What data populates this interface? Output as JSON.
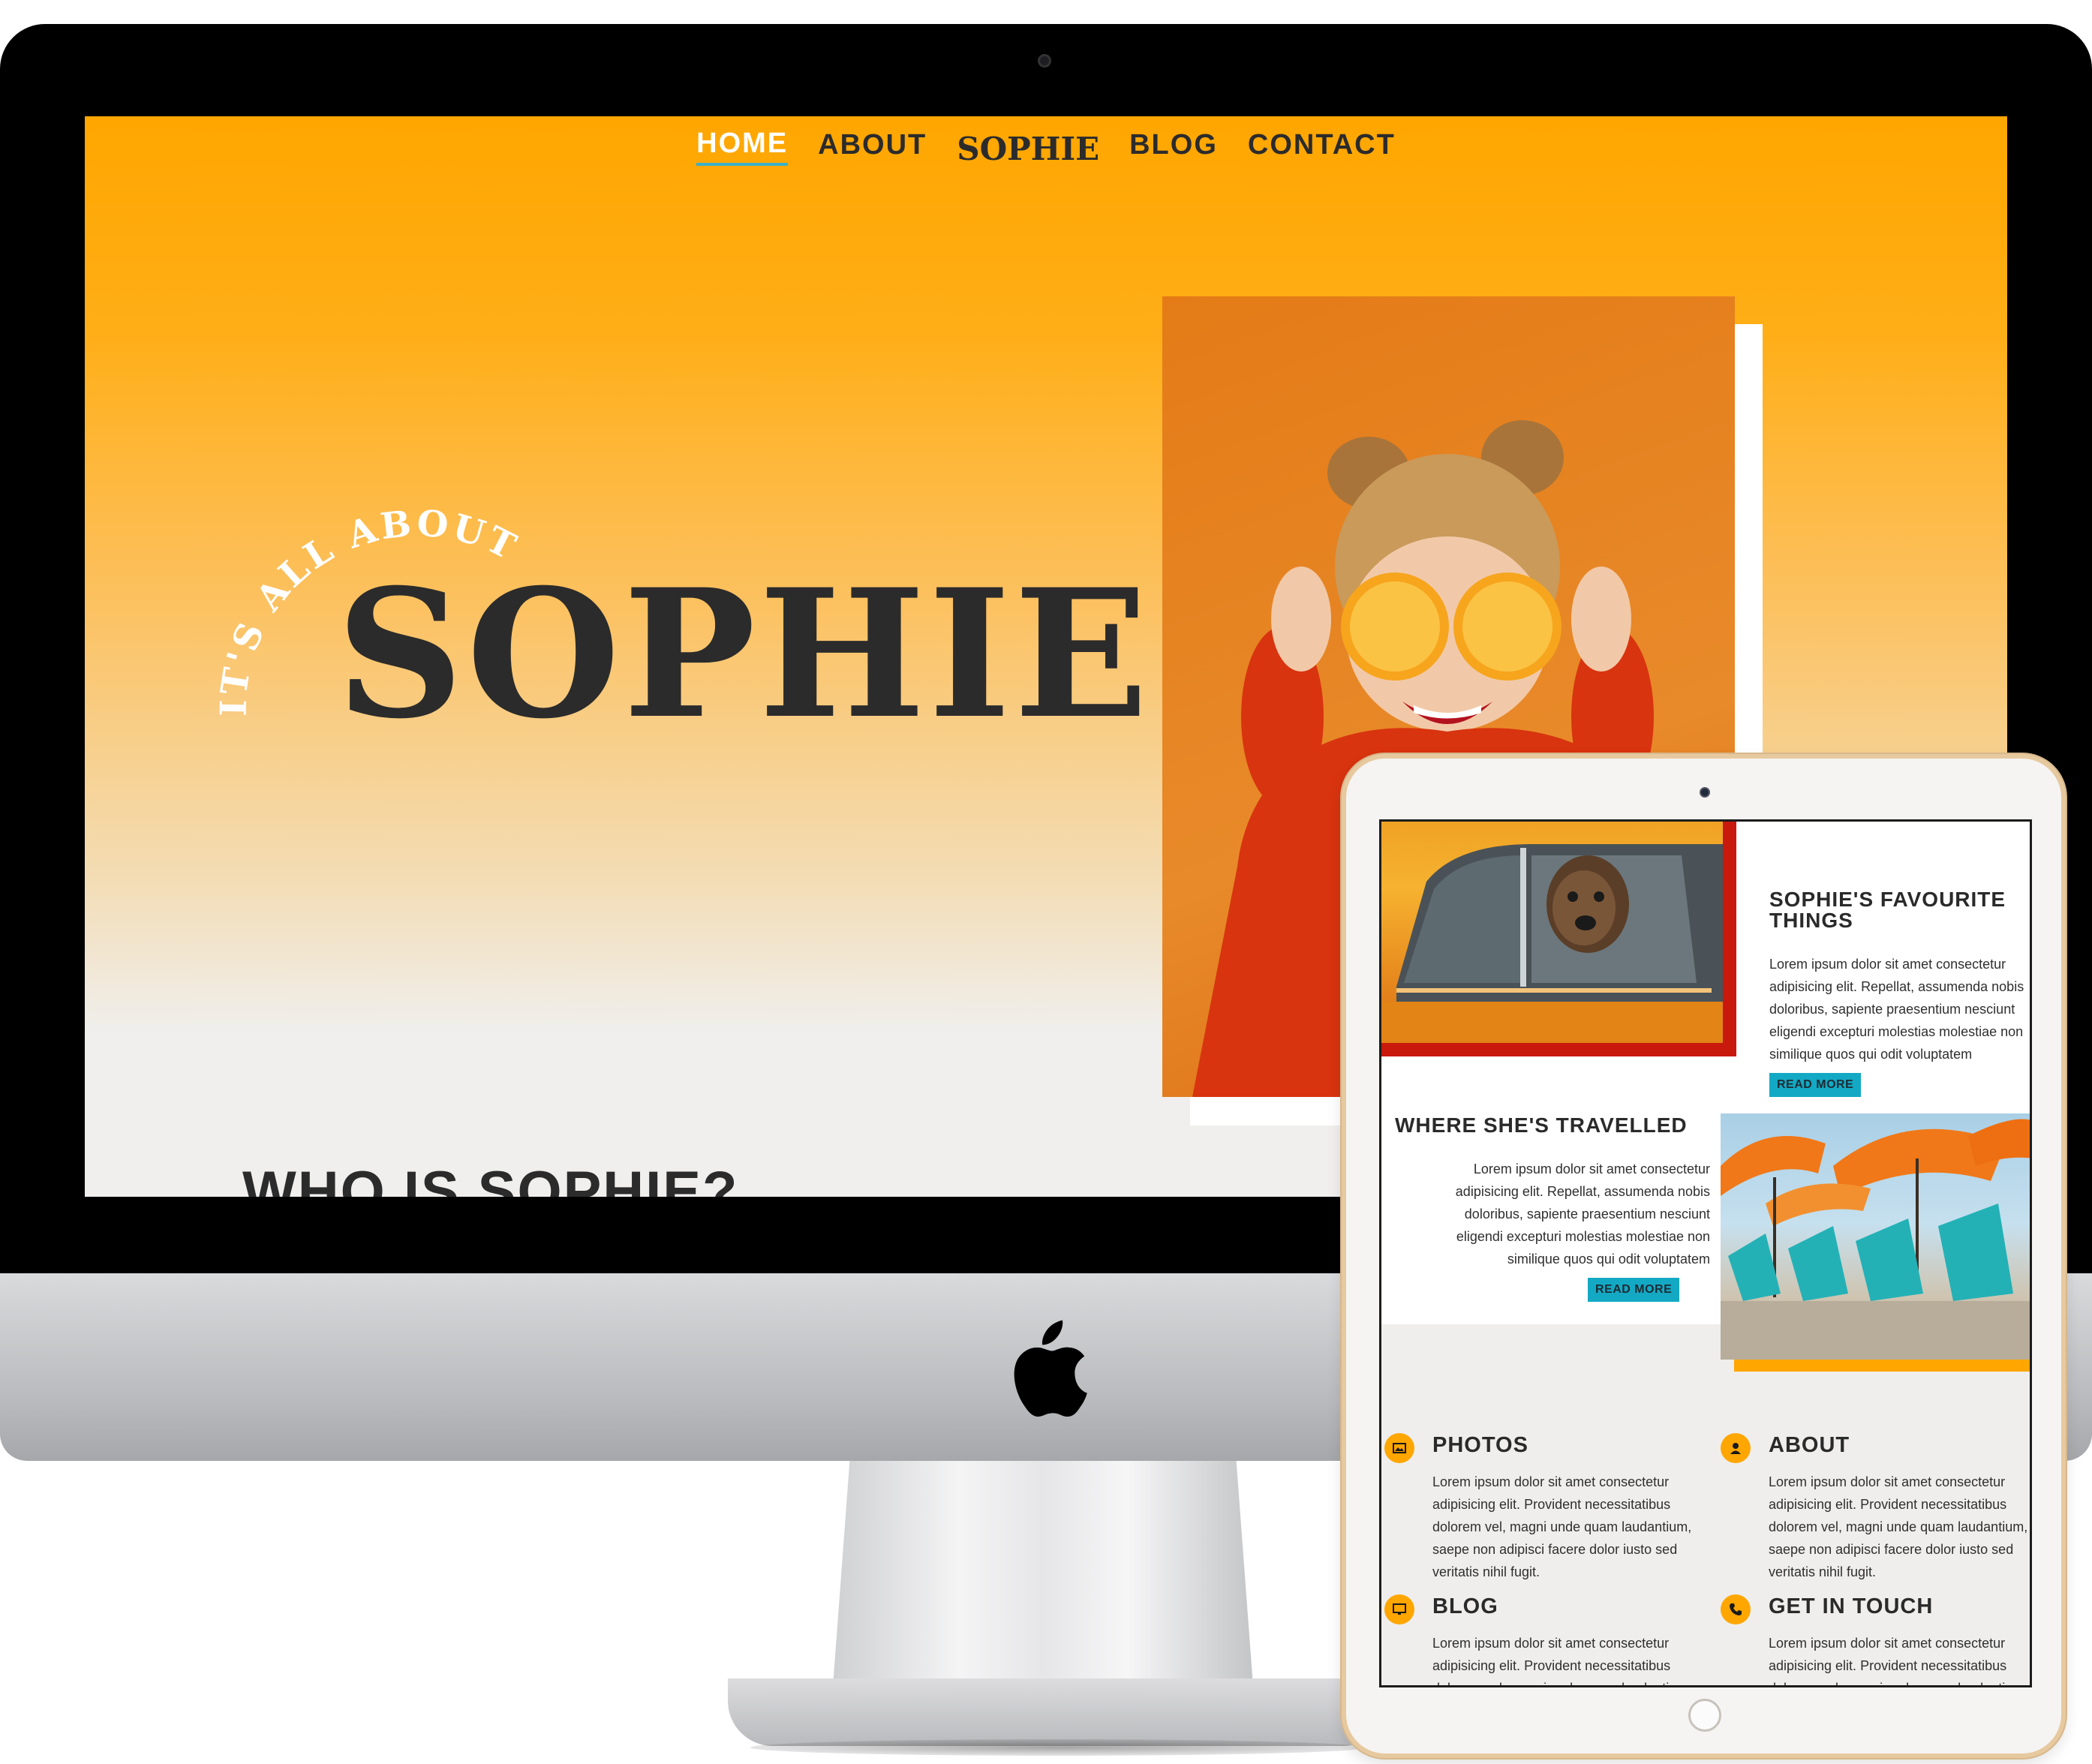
{
  "nav": {
    "items": [
      "HOME",
      "ABOUT"
    ],
    "logo": "SOPHIE",
    "items_right": [
      "BLOG",
      "CONTACT"
    ],
    "active": "HOME"
  },
  "hero": {
    "tagline": "IT'S ALL ABOUT",
    "title": "SOPHIE",
    "section_title": "WHO IS SOPHIE?"
  },
  "tablet": {
    "favourite": {
      "title": "SOPHIE'S FAVOURITE THINGS",
      "text_lines": [
        "Lorem ipsum dolor sit amet consectetur",
        "adipisicing elit. Repellat, assumenda nobis",
        "doloribus, sapiente praesentium nesciunt",
        "eligendi excepturi molestias molestiae non",
        "similique quos qui odit voluptatem"
      ],
      "button": "READ MORE"
    },
    "travelled": {
      "title": "WHERE SHE'S TRAVELLED",
      "text_lines": [
        "Lorem ipsum dolor sit amet consectetur",
        "adipisicing elit. Repellat, assumenda nobis",
        "doloribus, sapiente praesentium nesciunt",
        "eligendi excepturi molestias molestiae non",
        "similique quos qui odit voluptatem"
      ],
      "button": "READ MORE"
    },
    "features": [
      {
        "icon": "image-icon",
        "title": "PHOTOS",
        "text": "Lorem ipsum dolor sit amet consectetur adipisicing elit. Provident necessitatibus dolorem vel, magni unde quam laudantium, saepe non adipisci facere dolor iusto sed veritatis nihil fugit."
      },
      {
        "icon": "user-icon",
        "title": "ABOUT",
        "text": "Lorem ipsum dolor sit amet consectetur adipisicing elit. Provident necessitatibus dolorem vel, magni unde quam laudantium, saepe non adipisci facere dolor iusto sed veritatis nihil fugit."
      },
      {
        "icon": "monitor-icon",
        "title": "BLOG",
        "text": "Lorem ipsum dolor sit amet consectetur adipisicing elit. Provident necessitatibus dolorem vel, magni unde quam laudantium."
      },
      {
        "icon": "phone-icon",
        "title": "GET IN TOUCH",
        "text": "Lorem ipsum dolor sit amet consectetur adipisicing elit. Provident necessitatibus dolorem vel, magni unde quam laudantium."
      }
    ]
  },
  "colors": {
    "accent_orange": "#ffa600",
    "button_teal": "#13a9c4",
    "red_frame": "#c8190c",
    "text_dark": "#2b2b2b"
  }
}
